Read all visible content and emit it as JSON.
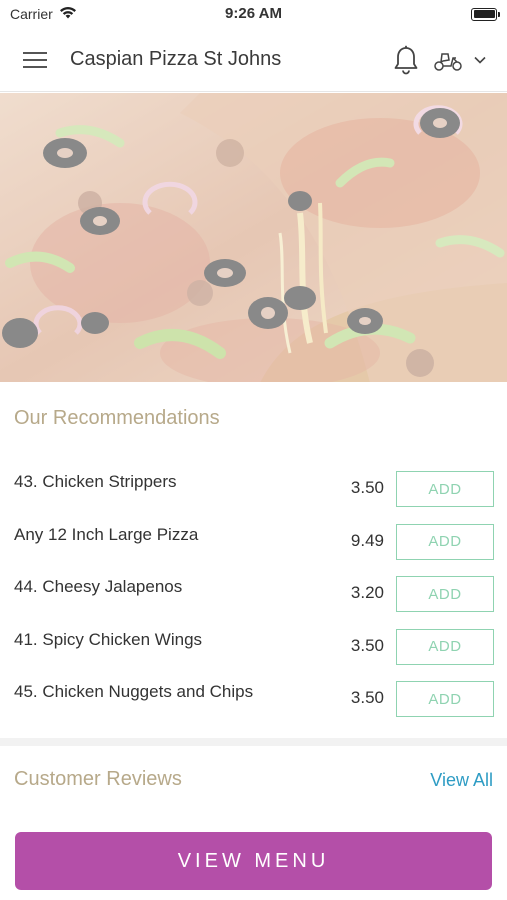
{
  "status_bar": {
    "carrier": "Carrier",
    "time": "9:26 AM"
  },
  "nav": {
    "title": "Caspian Pizza St Johns"
  },
  "recommendations": {
    "title": "Our Recommendations",
    "items": [
      {
        "name": "43. Chicken Strippers",
        "price": "3.50",
        "add_label": "ADD"
      },
      {
        "name": "Any 12 Inch Large Pizza",
        "price": "9.49",
        "add_label": "ADD"
      },
      {
        "name": "44. Cheesy Jalapenos",
        "price": "3.20",
        "add_label": "ADD"
      },
      {
        "name": "41. Spicy Chicken Wings",
        "price": "3.50",
        "add_label": "ADD"
      },
      {
        "name": "45. Chicken Nuggets and Chips",
        "price": "3.50",
        "add_label": "ADD"
      }
    ]
  },
  "reviews": {
    "title": "Customer Reviews",
    "view_all": "View All"
  },
  "footer": {
    "view_menu": "VIEW MENU"
  },
  "colors": {
    "accent": "#b44fa8",
    "add_border": "#8fd3b1",
    "section_title": "#b7a98a",
    "link": "#2e9cc4"
  },
  "icons": [
    "wifi-icon",
    "battery-icon",
    "hamburger-menu-icon",
    "bell-icon",
    "scooter-icon",
    "chevron-down-icon",
    "pizza-hero-image"
  ]
}
